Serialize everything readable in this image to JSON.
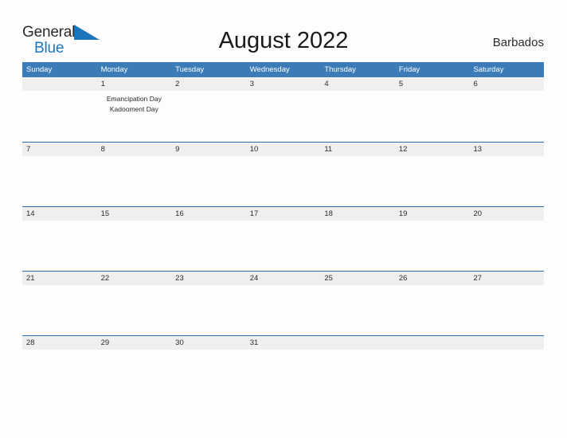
{
  "brand": {
    "name_line1": "General",
    "name_line2": "Blue",
    "color_dark": "#2b2b2b",
    "color_blue": "#1b75bb"
  },
  "header": {
    "title": "August 2022",
    "country": "Barbados"
  },
  "theme": {
    "header_blue": "#3b7cb8",
    "row_divider_blue": "#2f6ca8",
    "date_band_gray": "#efefef",
    "page_background": "#fdfdfd"
  },
  "calendar": {
    "weekdays": [
      "Sunday",
      "Monday",
      "Tuesday",
      "Wednesday",
      "Thursday",
      "Friday",
      "Saturday"
    ],
    "weeks": [
      {
        "days": [
          {
            "date": "",
            "events": []
          },
          {
            "date": "1",
            "events": [
              "Emancipation Day",
              "Kadooment Day"
            ]
          },
          {
            "date": "2",
            "events": []
          },
          {
            "date": "3",
            "events": []
          },
          {
            "date": "4",
            "events": []
          },
          {
            "date": "5",
            "events": []
          },
          {
            "date": "6",
            "events": []
          }
        ]
      },
      {
        "days": [
          {
            "date": "7",
            "events": []
          },
          {
            "date": "8",
            "events": []
          },
          {
            "date": "9",
            "events": []
          },
          {
            "date": "10",
            "events": []
          },
          {
            "date": "11",
            "events": []
          },
          {
            "date": "12",
            "events": []
          },
          {
            "date": "13",
            "events": []
          }
        ]
      },
      {
        "days": [
          {
            "date": "14",
            "events": []
          },
          {
            "date": "15",
            "events": []
          },
          {
            "date": "16",
            "events": []
          },
          {
            "date": "17",
            "events": []
          },
          {
            "date": "18",
            "events": []
          },
          {
            "date": "19",
            "events": []
          },
          {
            "date": "20",
            "events": []
          }
        ]
      },
      {
        "days": [
          {
            "date": "21",
            "events": []
          },
          {
            "date": "22",
            "events": []
          },
          {
            "date": "23",
            "events": []
          },
          {
            "date": "24",
            "events": []
          },
          {
            "date": "25",
            "events": []
          },
          {
            "date": "26",
            "events": []
          },
          {
            "date": "27",
            "events": []
          }
        ]
      },
      {
        "days": [
          {
            "date": "28",
            "events": []
          },
          {
            "date": "29",
            "events": []
          },
          {
            "date": "30",
            "events": []
          },
          {
            "date": "31",
            "events": []
          },
          {
            "date": "",
            "events": []
          },
          {
            "date": "",
            "events": []
          },
          {
            "date": "",
            "events": []
          }
        ]
      }
    ]
  }
}
